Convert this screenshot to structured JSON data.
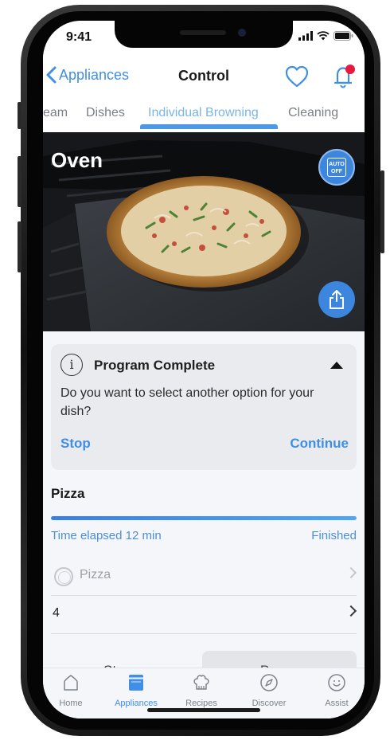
{
  "status": {
    "time": "9:41"
  },
  "nav": {
    "back_label": "Appliances",
    "title": "Control"
  },
  "tabs": [
    {
      "label": "eam",
      "active": false
    },
    {
      "label": "Dishes",
      "active": false
    },
    {
      "label": "Individual Browning",
      "active": true
    },
    {
      "label": "Cleaning",
      "active": false
    }
  ],
  "hero": {
    "title": "Oven",
    "auto_off_badge": "AUTO\nOFF"
  },
  "notice": {
    "title": "Program Complete",
    "message": "Do you want to select another option for your dish?",
    "stop_label": "Stop",
    "continue_label": "Continue"
  },
  "program": {
    "name": "Pizza",
    "progress": 1.0,
    "elapsed_text": "Time elapsed 12 min",
    "status_text": "Finished"
  },
  "options": [
    {
      "label": "Pizza",
      "disabled": true
    },
    {
      "label": "4",
      "disabled": false
    }
  ],
  "actions": {
    "stop_label": "Stop",
    "pause_label": "Pause"
  },
  "tabbar": [
    {
      "label": "Home",
      "icon": "home-icon",
      "active": false
    },
    {
      "label": "Appliances",
      "icon": "appliances-icon",
      "active": true
    },
    {
      "label": "Recipes",
      "icon": "chef-hat-icon",
      "active": false
    },
    {
      "label": "Discover",
      "icon": "compass-icon",
      "active": false
    },
    {
      "label": "Assist",
      "icon": "assist-icon",
      "active": false
    }
  ],
  "colors": {
    "accent": "#3f8ee8",
    "badge": "#e8193c",
    "card_bg": "#e9ebee"
  }
}
